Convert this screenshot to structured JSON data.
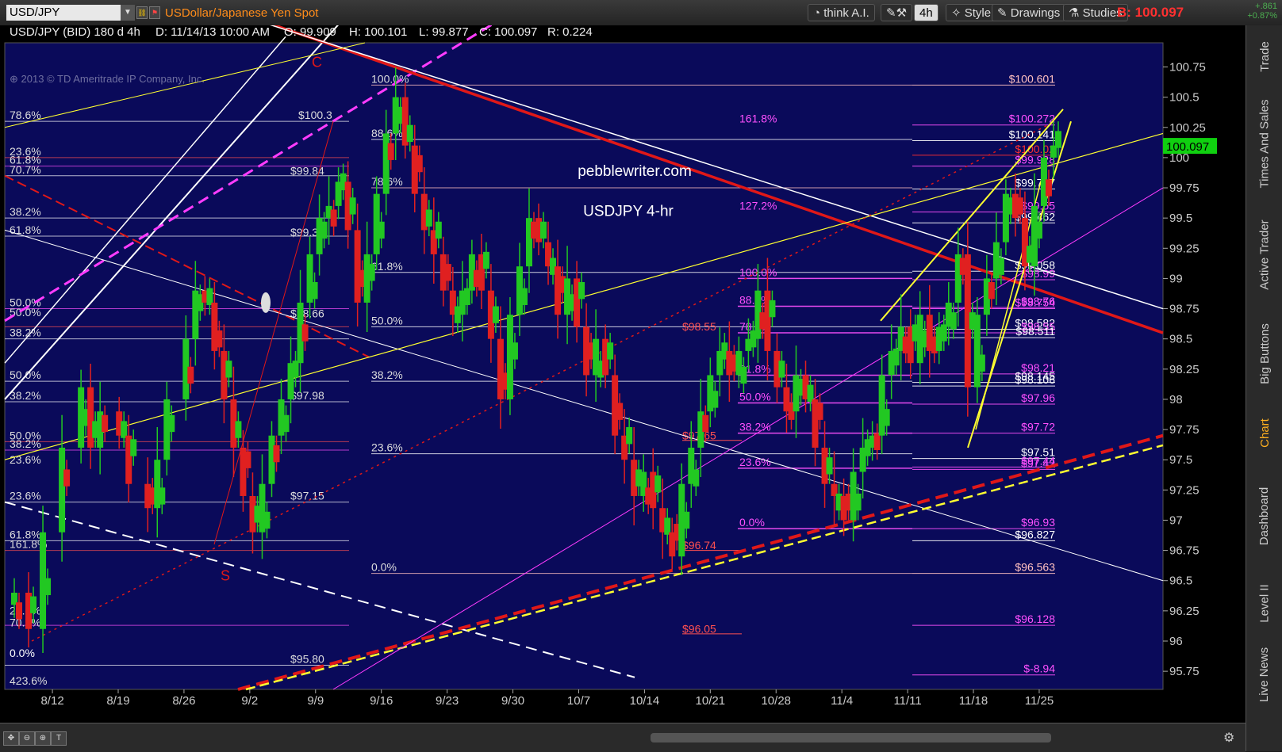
{
  "toolbar": {
    "symbol": "USD/JPY",
    "description": "USDollar/Japanese Yen Spot",
    "think_ai": "think A.I.",
    "interval": "4h",
    "style": "Style",
    "drawings": "Drawings",
    "studies": "Studies",
    "last_price": "B: 100.097",
    "change_abs": "+.861",
    "change_pct": "+0.87%"
  },
  "info": {
    "pair": "USD/JPY (BID) 180 d 4h",
    "date": "D: 11/14/13 10:00 AM",
    "open": "O: 99.909",
    "high": "H: 100.101",
    "low": "L: 99.877",
    "close": "C: 100.097",
    "range": "R: 0.224",
    "copyright": "2013 © TD Ameritrade IP Company, Inc."
  },
  "side_tabs": [
    "Trade",
    "Times And Sales",
    "Active Trader",
    "Big Buttons",
    "Chart",
    "Dashboard",
    "Level II",
    "Live News"
  ],
  "annotations": {
    "site": "pebblewriter.com",
    "subtitle": "USDJPY 4-hr",
    "c_label": "C",
    "s_label": "S"
  },
  "colors": {
    "chart_bg": "#0a0a5a",
    "up_candle": "#22c822",
    "down_candle": "#e02020",
    "white_line": "#ffffff",
    "red_line": "#e01818",
    "magenta": "#ff3cff",
    "yellow": "#ffff30",
    "current_price_bg": "#10d010"
  },
  "chart_data": {
    "type": "candlestick",
    "title": "USDJPY 4-hr",
    "x_ticks": [
      "8/12",
      "8/19",
      "8/26",
      "9/2",
      "9/9",
      "9/16",
      "9/23",
      "9/30",
      "10/7",
      "10/14",
      "10/21",
      "10/28",
      "11/4",
      "11/11",
      "11/18",
      "11/25"
    ],
    "y_ticks": [
      95.75,
      96,
      96.25,
      96.5,
      96.75,
      97,
      97.25,
      97.5,
      97.75,
      98,
      98.25,
      98.5,
      98.75,
      99,
      99.25,
      99.5,
      99.75,
      100,
      100.25,
      100.5,
      100.75
    ],
    "ylim": [
      95.6,
      100.95
    ],
    "current_price": "100.097",
    "close_path": [
      [
        0,
        96.4
      ],
      [
        1.5,
        96.1
      ],
      [
        3,
        96.9
      ],
      [
        5,
        97.6
      ],
      [
        7,
        98.1
      ],
      [
        8,
        97.6
      ],
      [
        9,
        97.9
      ],
      [
        11,
        97.7
      ],
      [
        12,
        97.3
      ],
      [
        14,
        97.1
      ],
      [
        15,
        97.5
      ],
      [
        16,
        98.0
      ],
      [
        18,
        98.5
      ],
      [
        19,
        98.9
      ],
      [
        20,
        98.8
      ],
      [
        21,
        98.4
      ],
      [
        22,
        98.0
      ],
      [
        23,
        97.6
      ],
      [
        24,
        97.2
      ],
      [
        25,
        96.9
      ],
      [
        26,
        97.3
      ],
      [
        27,
        97.7
      ],
      [
        28,
        98.0
      ],
      [
        29,
        98.3
      ],
      [
        30,
        98.8
      ],
      [
        31,
        99.2
      ],
      [
        32,
        99.5
      ],
      [
        33,
        99.6
      ],
      [
        34,
        99.8
      ],
      [
        35,
        99.4
      ],
      [
        36,
        98.8
      ],
      [
        37,
        99.2
      ],
      [
        38,
        99.7
      ],
      [
        39,
        100.2
      ],
      [
        40,
        100.5
      ],
      [
        41,
        100.1
      ],
      [
        42,
        99.7
      ],
      [
        43,
        99.4
      ],
      [
        44,
        99.2
      ],
      [
        45,
        98.9
      ],
      [
        46,
        98.7
      ],
      [
        47,
        98.9
      ],
      [
        48,
        99.2
      ],
      [
        49,
        98.9
      ],
      [
        50,
        98.5
      ],
      [
        51,
        98.0
      ],
      [
        52,
        98.7
      ],
      [
        53,
        99.1
      ],
      [
        54,
        99.5
      ],
      [
        55,
        99.3
      ],
      [
        56,
        99.1
      ],
      [
        57,
        98.7
      ],
      [
        58,
        99.0
      ],
      [
        59,
        98.6
      ],
      [
        60,
        98.2
      ],
      [
        61,
        98.5
      ],
      [
        62,
        98.2
      ],
      [
        63,
        97.7
      ],
      [
        64,
        97.5
      ],
      [
        65,
        97.2
      ],
      [
        66,
        97.4
      ],
      [
        67,
        97.1
      ],
      [
        68,
        96.9
      ],
      [
        69,
        96.7
      ],
      [
        70,
        97.3
      ],
      [
        71,
        97.6
      ],
      [
        72,
        97.9
      ],
      [
        73,
        98.2
      ],
      [
        74,
        98.4
      ],
      [
        75,
        98.2
      ],
      [
        76,
        98.4
      ],
      [
        77,
        98.5
      ],
      [
        78,
        98.9
      ],
      [
        79,
        98.4
      ],
      [
        80,
        98.1
      ],
      [
        81,
        97.9
      ],
      [
        82,
        98.2
      ],
      [
        83,
        98.0
      ],
      [
        84,
        97.6
      ],
      [
        85,
        97.3
      ],
      [
        86,
        97.2
      ],
      [
        87,
        97.0
      ],
      [
        88,
        97.4
      ],
      [
        89,
        97.6
      ],
      [
        90,
        97.7
      ],
      [
        91,
        98.2
      ],
      [
        92,
        98.4
      ],
      [
        93,
        98.6
      ],
      [
        94,
        98.3
      ],
      [
        95,
        98.7
      ],
      [
        96,
        98.4
      ],
      [
        97,
        98.6
      ],
      [
        98,
        98.8
      ],
      [
        99,
        99.2
      ],
      [
        100,
        98.1
      ],
      [
        101,
        98.7
      ],
      [
        102,
        99.0
      ],
      [
        103,
        99.3
      ],
      [
        104,
        99.7
      ],
      [
        105,
        99.5
      ],
      [
        106,
        99.1
      ],
      [
        107,
        99.6
      ],
      [
        108,
        100.0
      ],
      [
        109,
        100.1
      ]
    ],
    "horizontal_levels": [
      {
        "label": "$100.601",
        "value": 100.6,
        "color": "#ffc0c0"
      },
      {
        "label": "$100.272",
        "value": 100.27,
        "color": "#ff50ff"
      },
      {
        "label": "$100.141",
        "value": 100.14,
        "color": "#ffffff"
      },
      {
        "label": "$100.02",
        "value": 100.02,
        "color": "#ff3030"
      },
      {
        "label": "$99.928",
        "value": 99.93,
        "color": "#ff50ff"
      },
      {
        "label": "$99.737",
        "value": 99.74,
        "color": "#ffffff"
      },
      {
        "label": "$99.55",
        "value": 99.55,
        "color": "#ff50ff"
      },
      {
        "label": "$99.462",
        "value": 99.46,
        "color": "#ffffff"
      },
      {
        "label": "$99.058",
        "value": 99.06,
        "color": "#ffffff"
      },
      {
        "label": "$98.99",
        "value": 98.99,
        "color": "#ff50ff"
      },
      {
        "label": "$98.76",
        "value": 98.76,
        "color": "#ff50ff"
      },
      {
        "label": "$98.754",
        "value": 98.75,
        "color": "#ff50ff"
      },
      {
        "label": "$98.582",
        "value": 98.58,
        "color": "#ffffff"
      },
      {
        "label": "$98.55",
        "value": 98.55,
        "color": "#ff50ff"
      },
      {
        "label": "$98.511",
        "value": 98.51,
        "color": "#ffffff"
      },
      {
        "label": "$98.21",
        "value": 98.21,
        "color": "#ff50ff"
      },
      {
        "label": "$98.145",
        "value": 98.14,
        "color": "#ffffff"
      },
      {
        "label": "$98.106",
        "value": 98.11,
        "color": "#ffffff"
      },
      {
        "label": "$97.96",
        "value": 97.96,
        "color": "#ff50ff"
      },
      {
        "label": "$97.72",
        "value": 97.72,
        "color": "#ff50ff"
      },
      {
        "label": "$97.51",
        "value": 97.51,
        "color": "#ffffff"
      },
      {
        "label": "$97.44",
        "value": 97.44,
        "color": "#ff50ff"
      },
      {
        "label": "$97.42",
        "value": 97.42,
        "color": "#ff50ff"
      },
      {
        "label": "$96.93",
        "value": 96.93,
        "color": "#ff50ff"
      },
      {
        "label": "$96.827",
        "value": 96.83,
        "color": "#ffffff"
      },
      {
        "label": "$96.563",
        "value": 96.56,
        "color": "#ffc0c0"
      },
      {
        "label": "$96.128",
        "value": 96.13,
        "color": "#ff50ff"
      },
      {
        "label": "$-8.94",
        "value": 95.72,
        "color": "#ff50ff"
      }
    ],
    "fib_labels": [
      {
        "label": "100.0%"
      },
      {
        "label": "88.6%"
      },
      {
        "label": "78.6%"
      },
      {
        "label": "61.8%"
      },
      {
        "label": "50.0%"
      },
      {
        "label": "38.2%"
      },
      {
        "label": "23.6%"
      },
      {
        "label": "0.0%"
      },
      {
        "label": "161.8%"
      },
      {
        "label": "127.2%"
      },
      {
        "label": "70.7%"
      },
      {
        "label": "423.6%"
      }
    ],
    "price_labels": [
      "$100.3",
      "$99.84",
      "$99.33",
      "$98.66",
      "$97.98",
      "$97.15",
      "$95.80",
      "$98.55",
      "$97.65",
      "$96.74",
      "$96.05"
    ]
  }
}
